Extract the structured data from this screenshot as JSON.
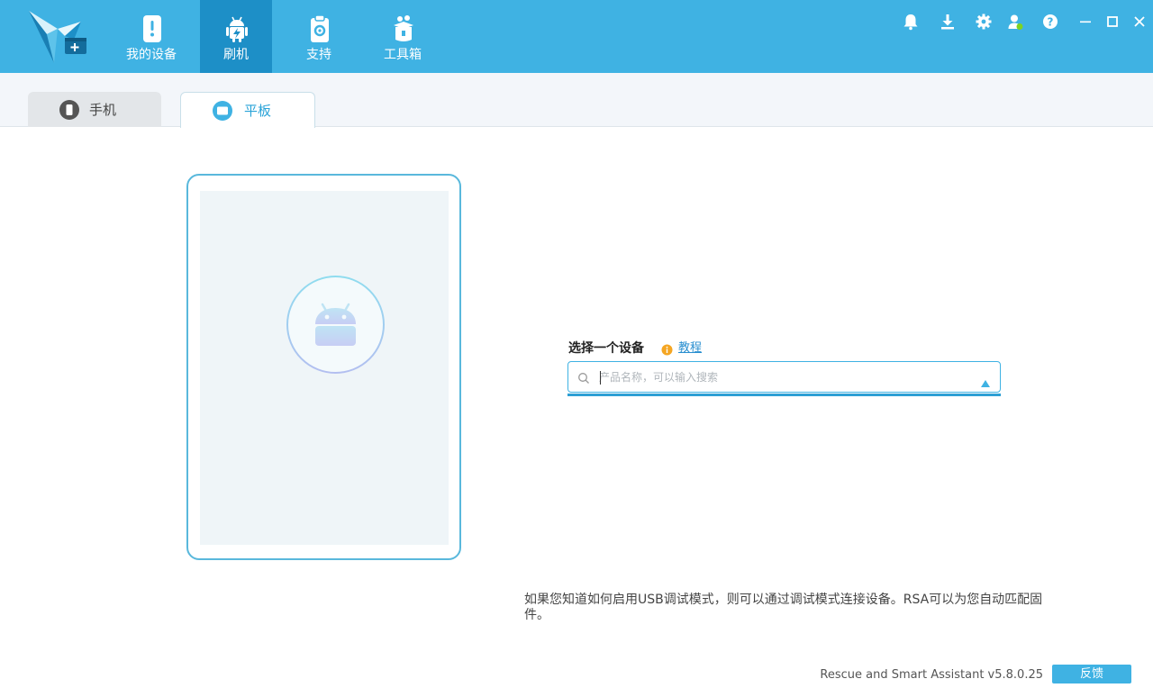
{
  "header": {
    "nav": [
      {
        "label": "我的设备",
        "icon": "phone-alert-icon"
      },
      {
        "label": "刷机",
        "icon": "android-flash-icon",
        "active": true
      },
      {
        "label": "支持",
        "icon": "support-clipboard-icon"
      },
      {
        "label": "工具箱",
        "icon": "toolbox-icon"
      }
    ],
    "window_icons": [
      "bell-icon",
      "download-icon",
      "gear-icon",
      "user-icon",
      "help-icon",
      "minimize-icon",
      "maximize-icon",
      "close-icon"
    ]
  },
  "tabs": [
    {
      "label": "手机",
      "icon": "phone-icon",
      "active": false
    },
    {
      "label": "平板",
      "icon": "tablet-icon",
      "active": true
    }
  ],
  "device_select": {
    "label": "选择一个设备",
    "tutorial_link": "教程",
    "search_placeholder": "产品名称，可以输入搜索"
  },
  "hint": "如果您知道如何启用USB调试模式，则可以通过调试模式连接设备。RSA可以为您自动匹配固件。",
  "footer": {
    "version": "Rescue and Smart Assistant v5.8.0.25",
    "feedback_label": "反馈"
  },
  "colors": {
    "header_bg": "#3fb2e3",
    "nav_active_bg": "#1d8fc7",
    "accent": "#29a3d8",
    "link": "#2a8fd0"
  }
}
